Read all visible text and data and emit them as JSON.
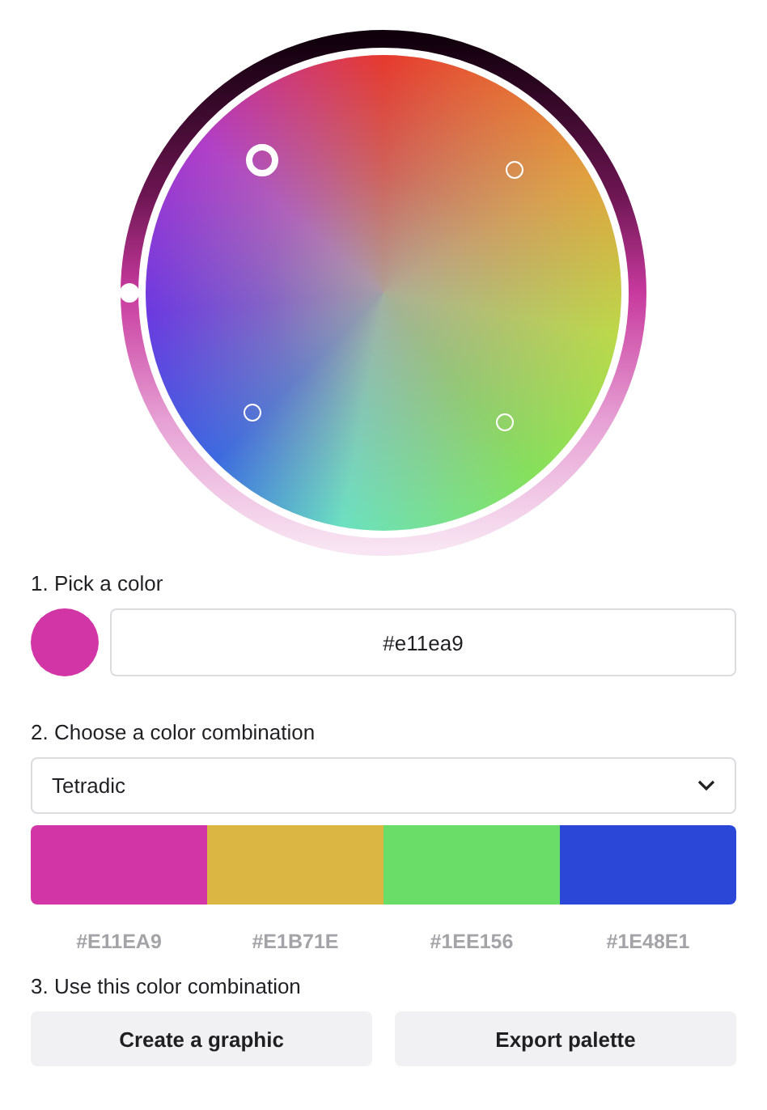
{
  "wheel": {
    "markers": [
      {
        "selected": true
      },
      {
        "selected": false
      },
      {
        "selected": false
      },
      {
        "selected": false
      }
    ]
  },
  "pick": {
    "label": "1. Pick a color",
    "color": "#d236a6",
    "value": "#e11ea9"
  },
  "combination": {
    "label": "2. Choose a color combination",
    "value": "Tetradic"
  },
  "palette": [
    {
      "color": "#d236a6",
      "hex": "#E11EA9"
    },
    {
      "color": "#dcb643",
      "hex": "#E1B71E"
    },
    {
      "color": "#6add69",
      "hex": "#1EE156"
    },
    {
      "color": "#2a47d8",
      "hex": "#1E48E1"
    }
  ],
  "use": {
    "label": "3. Use this color combination",
    "buttons": [
      "Create a graphic",
      "Export palette"
    ]
  }
}
